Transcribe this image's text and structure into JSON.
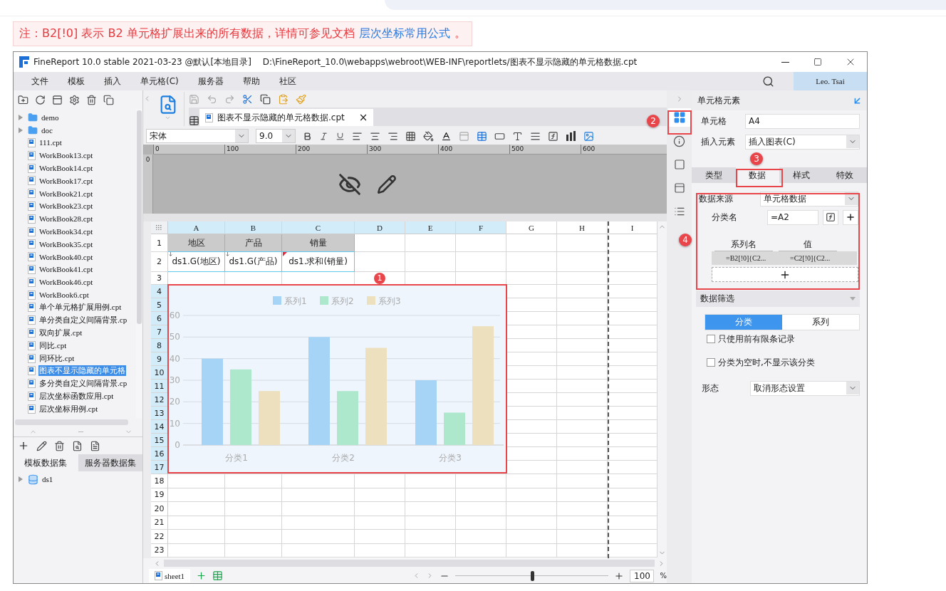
{
  "note": {
    "text": "注：B2[!0] 表示 B2 单元格扩展出来的所有数据，详情可参见文档",
    "link": "层次坐标常用公式",
    "tail": "。"
  },
  "window": {
    "title": "FineReport 10.0 stable 2021-03-23 @默认[本地目录]",
    "path": "D:\\FineReport_10.0\\webapps\\webroot\\WEB-INF\\reportlets/图表不显示隐藏的单元格数据.cpt"
  },
  "menu": [
    "文件",
    "模板",
    "插入",
    "单元格(C)",
    "服务器",
    "帮助",
    "社区"
  ],
  "user": "Leo. Tsai",
  "file_tree": [
    {
      "name": "demo",
      "kind": "folder",
      "selected": false
    },
    {
      "name": "doc",
      "kind": "folder",
      "selected": false
    },
    {
      "name": "111.cpt",
      "kind": "file",
      "selected": false
    },
    {
      "name": "WorkBook13.cpt",
      "kind": "file",
      "selected": false
    },
    {
      "name": "WorkBook14.cpt",
      "kind": "file",
      "selected": false
    },
    {
      "name": "WorkBook17.cpt",
      "kind": "file",
      "selected": false
    },
    {
      "name": "WorkBook21.cpt",
      "kind": "file",
      "selected": false
    },
    {
      "name": "WorkBook23.cpt",
      "kind": "file",
      "selected": false
    },
    {
      "name": "WorkBook28.cpt",
      "kind": "file",
      "selected": false
    },
    {
      "name": "WorkBook34.cpt",
      "kind": "file",
      "selected": false
    },
    {
      "name": "WorkBook35.cpt",
      "kind": "file",
      "selected": false
    },
    {
      "name": "WorkBook40.cpt",
      "kind": "file",
      "selected": false
    },
    {
      "name": "WorkBook41.cpt",
      "kind": "file",
      "selected": false
    },
    {
      "name": "WorkBook46.cpt",
      "kind": "file",
      "selected": false
    },
    {
      "name": "WorkBook6.cpt",
      "kind": "file",
      "selected": false
    },
    {
      "name": "单个单元格扩展用例.cpt",
      "kind": "file",
      "selected": false
    },
    {
      "name": "单分类自定义间隔背景.cp",
      "kind": "file",
      "selected": false
    },
    {
      "name": "双向扩展.cpt",
      "kind": "file",
      "selected": false
    },
    {
      "name": "同比.cpt",
      "kind": "file",
      "selected": false
    },
    {
      "name": "同环比.cpt",
      "kind": "file",
      "selected": false
    },
    {
      "name": "图表不显示隐藏的单元格",
      "kind": "file",
      "selected": true
    },
    {
      "name": "多分类自定义间隔背景.cp",
      "kind": "file",
      "selected": false
    },
    {
      "name": "层次坐标函数应用.cpt",
      "kind": "file",
      "selected": false
    },
    {
      "name": "层次坐标用例.cpt",
      "kind": "file",
      "selected": false
    }
  ],
  "dataset_tabs": [
    {
      "label": "模板数据集",
      "selected": true
    },
    {
      "label": "服务器数据集",
      "selected": false
    }
  ],
  "datasets": [
    {
      "name": "ds1"
    }
  ],
  "editor_tab": {
    "label": "图表不显示隐藏的单元格数据.cpt",
    "close": "×"
  },
  "format_bar": {
    "font": "宋体",
    "size": "9.0"
  },
  "ruler_ticks": [
    "0",
    "100",
    "200",
    "300",
    "400",
    "500",
    "600"
  ],
  "left_ruler_label": "0",
  "sheet": {
    "columns": [
      {
        "label": "A",
        "selected": true
      },
      {
        "label": "B",
        "selected": true
      },
      {
        "label": "C",
        "selected": true
      },
      {
        "label": "D",
        "selected": true
      },
      {
        "label": "E",
        "selected": true
      },
      {
        "label": "F",
        "selected": true
      },
      {
        "label": "G",
        "selected": false
      },
      {
        "label": "H",
        "selected": false
      },
      {
        "label": "I",
        "selected": false
      }
    ],
    "rows": [
      {
        "label": "1",
        "selected": false,
        "cells": [
          {
            "text": "地区",
            "kind": "header"
          },
          {
            "text": "产品",
            "kind": "header"
          },
          {
            "text": "销量",
            "kind": "header"
          }
        ]
      },
      {
        "label": "2",
        "selected": false,
        "cells": [
          {
            "text": "ds1.G(地区)",
            "kind": "expand"
          },
          {
            "text": "ds1.G(产品)",
            "kind": "expand"
          },
          {
            "text": "ds1.求和(销量)",
            "kind": "flagged"
          }
        ]
      },
      {
        "label": "3",
        "selected": false
      },
      {
        "label": "4",
        "selected": true
      },
      {
        "label": "5",
        "selected": true
      },
      {
        "label": "6",
        "selected": true
      },
      {
        "label": "7",
        "selected": true
      },
      {
        "label": "8",
        "selected": true
      },
      {
        "label": "9",
        "selected": true
      },
      {
        "label": "10",
        "selected": true
      },
      {
        "label": "11",
        "selected": true
      },
      {
        "label": "12",
        "selected": true
      },
      {
        "label": "13",
        "selected": true
      },
      {
        "label": "14",
        "selected": true
      },
      {
        "label": "15",
        "selected": true
      },
      {
        "label": "16",
        "selected": true
      },
      {
        "label": "17",
        "selected": true
      },
      {
        "label": "18",
        "selected": false
      },
      {
        "label": "19",
        "selected": false
      },
      {
        "label": "20",
        "selected": false
      },
      {
        "label": "21",
        "selected": false
      },
      {
        "label": "22",
        "selected": false
      },
      {
        "label": "23",
        "selected": false
      }
    ],
    "chart": {
      "chart_data": {
        "type": "bar",
        "categories": [
          "分类1",
          "分类2",
          "分类3"
        ],
        "series": [
          {
            "name": "系列1",
            "color": "#a6d4f7",
            "values": [
              40,
              50,
              30
            ]
          },
          {
            "name": "系列2",
            "color": "#aee8cc",
            "values": [
              35,
              25,
              15
            ]
          },
          {
            "name": "系列3",
            "color": "#ede0be",
            "values": [
              25,
              45,
              55
            ]
          }
        ],
        "ylim": [
          0,
          60
        ],
        "yticks": [
          0,
          10,
          20,
          30,
          40,
          50,
          60
        ],
        "grid": true,
        "legend": true
      }
    }
  },
  "sheet_tabs": [
    {
      "label": "sheet1",
      "selected": true
    }
  ],
  "zoom": {
    "level": 0.5,
    "value": "100",
    "unit": "%"
  },
  "callouts": [
    "1",
    "2",
    "3",
    "4"
  ],
  "panel": {
    "title": "单元格元素",
    "cell_label": "单元格",
    "cell_value": "A4",
    "insert_label": "插入元素",
    "insert_value": "插入图表(C)",
    "tabs": [
      {
        "label": "类型",
        "selected": false
      },
      {
        "label": "数据",
        "selected": true
      },
      {
        "label": "样式",
        "selected": false
      },
      {
        "label": "特效",
        "selected": false
      }
    ],
    "source_label": "数据来源",
    "source_value": "单元格数据",
    "category_label": "分类名",
    "category_value": "=A2",
    "series_headers": [
      "系列名",
      "值"
    ],
    "series_rows": [
      [
        "=B2[!0]{C2...",
        "=C2[!0]{C2..."
      ]
    ],
    "filter_title": "数据筛选",
    "filter_tabs": [
      {
        "label": "分类",
        "selected": true
      },
      {
        "label": "系列",
        "selected": false
      }
    ],
    "options": [
      {
        "label": "只使用前有限条记录",
        "checked": false
      },
      {
        "label": "分类为空时,不显示该分类",
        "checked": false
      }
    ],
    "shape_label": "形态",
    "shape_value": "取消形态设置"
  }
}
